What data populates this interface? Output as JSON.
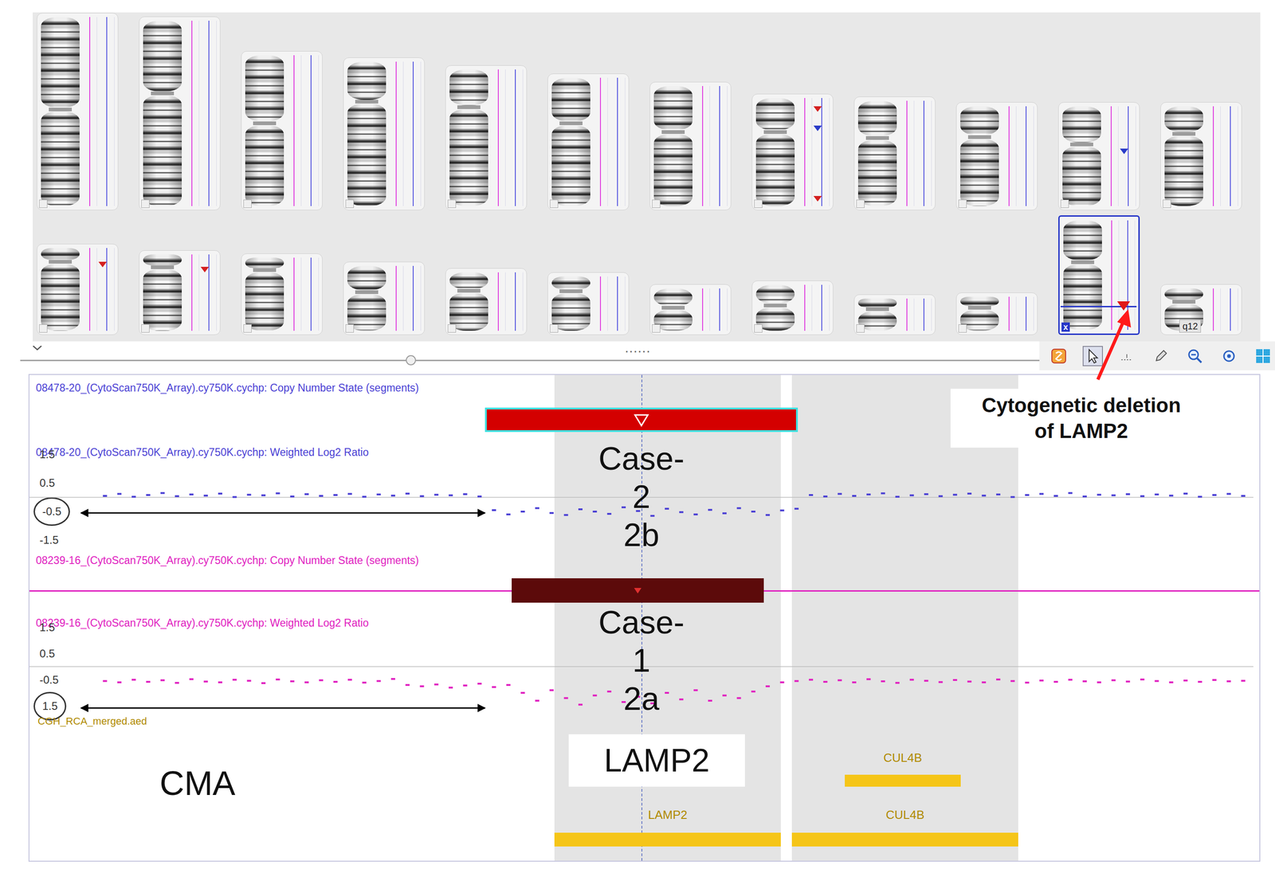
{
  "karyotype": {
    "chromosomes": [
      {
        "selected": false,
        "marks": []
      },
      {
        "selected": false,
        "marks": []
      },
      {
        "selected": false,
        "marks": []
      },
      {
        "selected": false,
        "marks": []
      },
      {
        "selected": false,
        "marks": []
      },
      {
        "selected": false,
        "marks": []
      },
      {
        "selected": false,
        "marks": []
      },
      {
        "selected": false,
        "marks": [
          {
            "at": 0.1,
            "color": "#d42020"
          },
          {
            "at": 0.28,
            "color": "#2a3cc8"
          },
          {
            "at": 0.93,
            "color": "#d42020"
          }
        ]
      },
      {
        "selected": false,
        "marks": []
      },
      {
        "selected": false,
        "marks": []
      },
      {
        "selected": false,
        "marks": [
          {
            "at": 0.45,
            "color": "#2a3cc8"
          }
        ]
      },
      {
        "selected": false,
        "marks": []
      },
      {
        "selected": false,
        "marks": [
          {
            "at": 0.2,
            "color": "#d42020"
          }
        ]
      },
      {
        "selected": false,
        "marks": [
          {
            "at": 0.2,
            "color": "#d42020"
          }
        ]
      },
      {
        "selected": false,
        "marks": []
      },
      {
        "selected": false,
        "marks": []
      },
      {
        "selected": false,
        "marks": []
      },
      {
        "selected": false,
        "marks": []
      },
      {
        "selected": false,
        "marks": []
      },
      {
        "selected": false,
        "marks": []
      },
      {
        "selected": false,
        "marks": []
      },
      {
        "selected": false,
        "marks": []
      },
      {
        "selected": true,
        "badge": "x",
        "marks": [
          {
            "at": 0.78,
            "color": "#e01818"
          }
        ]
      },
      {
        "selected": false,
        "badge": "q12",
        "marks": []
      }
    ]
  },
  "splitter": "......",
  "toolbar": [
    {
      "kind": "palette",
      "selected": false
    },
    {
      "kind": "pointer",
      "selected": true
    },
    {
      "kind": "select",
      "selected": false
    },
    {
      "kind": "pencil",
      "selected": false
    },
    {
      "kind": "zoom-out",
      "selected": false
    },
    {
      "kind": "zoom-fit",
      "selected": false
    },
    {
      "kind": "grid",
      "selected": false
    }
  ],
  "cursor_position": 0.5,
  "tracks": [
    {
      "segment_title": "08478-20_(CytoScan750K_Array).cy750K.cychp: Copy Number State (segments)",
      "segment": {
        "start": 0.372,
        "end": 0.628,
        "color": "#d40000",
        "selected": true
      },
      "ratio_title": "08478-20_(CytoScan750K_Array).cy750K.cychp: Weighted Log2 Ratio",
      "ticks": [
        {
          "label": "1.5",
          "value": 1.5,
          "circled": false
        },
        {
          "label": "0.5",
          "value": 0.5,
          "circled": false
        },
        {
          "label": "-0.5",
          "value": -0.5,
          "circled": true
        },
        {
          "label": "-1.5",
          "value": -1.5,
          "circled": false
        }
      ],
      "case_label": [
        "Case-",
        "2",
        "2b"
      ],
      "color": "#4a3fd4",
      "values": [
        0.05,
        0.12,
        0.02,
        0.08,
        0.15,
        0.04,
        0.1,
        0.06,
        0.13,
        0.01,
        0.09,
        0.07,
        0.14,
        0.03,
        0.11,
        0.05,
        0.08,
        0.12,
        0.02,
        0.1,
        0.06,
        0.13,
        0.04,
        0.09,
        0.07,
        0.11,
        0.03,
        -0.45,
        -0.6,
        -0.5,
        -0.38,
        -0.55,
        -0.62,
        -0.42,
        -0.5,
        -0.58,
        -0.35,
        -0.48,
        -0.65,
        -0.4,
        -0.52,
        -0.6,
        -0.44,
        -0.56,
        -0.38,
        -0.5,
        -0.62,
        -0.46,
        -0.4,
        0.08,
        0.03,
        0.12,
        0.05,
        0.1,
        0.14,
        0.02,
        0.07,
        0.11,
        0.04,
        0.09,
        0.13,
        0.06,
        0.1,
        0.01,
        0.08,
        0.12,
        0.05,
        0.15,
        0.03,
        0.09,
        0.07,
        0.11,
        0.04,
        0.1,
        0.06,
        0.13,
        0.02,
        0.08,
        0.12,
        0.05
      ]
    },
    {
      "segment_title": "08239-16_(CytoScan750K_Array).cy750K.cychp: Copy Number State (segments)",
      "segment": {
        "start": 0.394,
        "end": 0.6,
        "color": "#5c0a0a",
        "selected": false
      },
      "ratio_title": "08239-16_(CytoScan750K_Array).cy750K.cychp: Weighted Log2 Ratio",
      "ticks": [
        {
          "label": "1.5",
          "value": 1.5,
          "circled": false
        },
        {
          "label": "0.5",
          "value": 0.5,
          "circled": false
        },
        {
          "label": "-0.5",
          "value": -0.5,
          "circled": false
        },
        {
          "label": "1.5",
          "value": -1.5,
          "circled": true
        }
      ],
      "case_label": [
        "Case-",
        "1",
        "2a"
      ],
      "color": "#e020c0",
      "values": [
        -0.55,
        -0.6,
        -0.5,
        -0.58,
        -0.52,
        -0.62,
        -0.48,
        -0.57,
        -0.6,
        -0.5,
        -0.54,
        -0.63,
        -0.49,
        -0.56,
        -0.6,
        -0.52,
        -0.58,
        -0.5,
        -0.61,
        -0.55,
        -0.47,
        -0.7,
        -0.75,
        -0.68,
        -0.8,
        -0.72,
        -0.65,
        -0.78,
        -0.7,
        -1.0,
        -1.3,
        -0.9,
        -1.2,
        -1.45,
        -1.1,
        -0.95,
        -1.35,
        -1.15,
        -1.4,
        -1.0,
        -1.25,
        -0.9,
        -1.3,
        -1.1,
        -1.2,
        -0.95,
        -0.75,
        -0.6,
        -0.55,
        -0.5,
        -0.58,
        -0.52,
        -0.6,
        -0.48,
        -0.56,
        -0.62,
        -0.5,
        -0.54,
        -0.59,
        -0.51,
        -0.57,
        -0.6,
        -0.49,
        -0.55,
        -0.61,
        -0.53,
        -0.58,
        -0.5,
        -0.56,
        -0.6,
        -0.52,
        -0.57,
        -0.49,
        -0.55,
        -0.6,
        -0.53,
        -0.58,
        -0.51,
        -0.56,
        -0.54
      ]
    }
  ],
  "annotation_file": "CGH_RCA_merged.aed",
  "gene_rows": [
    {
      "genes": [
        {
          "name": "CUL4B",
          "start": 0.666,
          "end": 0.761,
          "highlight": false
        }
      ]
    },
    {
      "genes": [
        {
          "name": "LAMP2",
          "start": 0.429,
          "end": 0.614,
          "highlight": true
        },
        {
          "name": "CUL4B",
          "start": 0.623,
          "end": 0.808,
          "highlight": true
        }
      ]
    }
  ],
  "gene_callout": "LAMP2",
  "method_label": "CMA",
  "deletion_callout": [
    "Cytogenetic deletion",
    "of LAMP2"
  ]
}
